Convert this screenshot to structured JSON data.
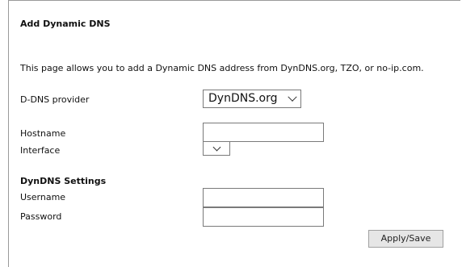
{
  "title": "Add Dynamic DNS",
  "description": "This page allows you to add a Dynamic DNS address from DynDNS.org, TZO, or no-ip.com.",
  "provider": {
    "label": "D-DNS provider",
    "selected": "DynDNS.org"
  },
  "hostname": {
    "label": "Hostname",
    "value": ""
  },
  "interface": {
    "label": "Interface",
    "selected": ""
  },
  "section_title": "DynDNS Settings",
  "username": {
    "label": "Username",
    "value": ""
  },
  "password": {
    "label": "Password",
    "value": ""
  },
  "apply_label": "Apply/Save"
}
